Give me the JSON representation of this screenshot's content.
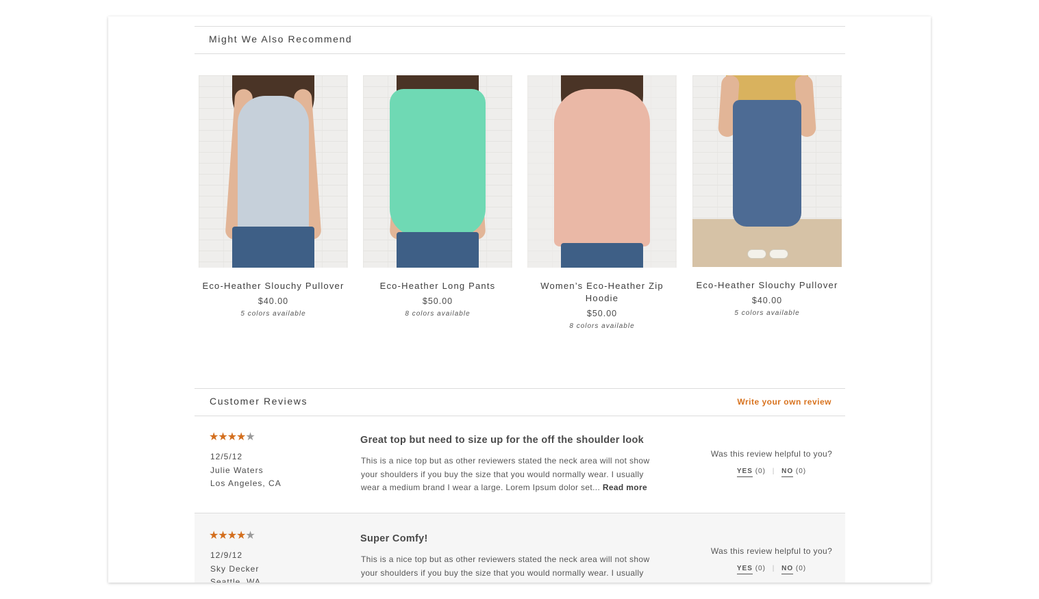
{
  "recommendations": {
    "title": "Might We Also Recommend",
    "products": [
      {
        "name": "Eco-Heather Slouchy Pullover",
        "price": "$40.00",
        "colors": "5 colors available",
        "image": "woman-light-blue-tank-top-photo",
        "shirt_color": "#c6d0da"
      },
      {
        "name": "Eco-Heather Long Pants",
        "price": "$50.00",
        "colors": "8 colors available",
        "image": "woman-mint-sleeveless-blouse-photo",
        "shirt_color": "#6fd9b4"
      },
      {
        "name": "Women’s Eco-Heather Zip Hoodie",
        "price": "$50.00",
        "colors": "8 colors available",
        "image": "woman-peach-tshirt-photo",
        "shirt_color": "#eab8a6"
      },
      {
        "name": "Eco-Heather Slouchy Pullover",
        "price": "$40.00",
        "colors": "5 colors available",
        "image": "woman-blue-pants-photo",
        "shirt_color": "#d9b25e"
      }
    ]
  },
  "reviews": {
    "title": "Customer Reviews",
    "write_link": "Write your own review",
    "items": [
      {
        "rating": 4,
        "max": 5,
        "date": "12/5/12",
        "author": "Julie Waters",
        "location": "Los Angeles, CA",
        "title": "Great top but need to size up for the off the shoulder look",
        "body_lines": [
          "This is a nice top but as other reviewers stated the neck area will not show",
          "your shoulders if you buy the size that you would normally wear. I usually",
          "wear a medium  brand I wear a large.  Lorem Ipsum dolor set..."
        ],
        "read_more": "Read more",
        "helpful_q": "Was this review helpful to you?",
        "yes_label": "YES",
        "yes_count": "(0)",
        "no_label": "NO",
        "no_count": "(0)"
      },
      {
        "rating": 4,
        "max": 5,
        "date": "12/9/12",
        "author": "Sky Decker",
        "location": "Seattle, WA",
        "title": "Super Comfy!",
        "body_lines": [
          "This is a nice top but as other reviewers stated the neck area will not show",
          "your shoulders if you buy the size that you would normally wear. I usually"
        ],
        "helpful_q": "Was this review helpful to you?",
        "yes_label": "YES",
        "yes_count": "(0)",
        "no_label": "NO",
        "no_count": "(0)"
      }
    ]
  },
  "colors": {
    "accent": "#d8731f",
    "star_on": "#d36e1d",
    "star_off": "#9a9a9a"
  }
}
